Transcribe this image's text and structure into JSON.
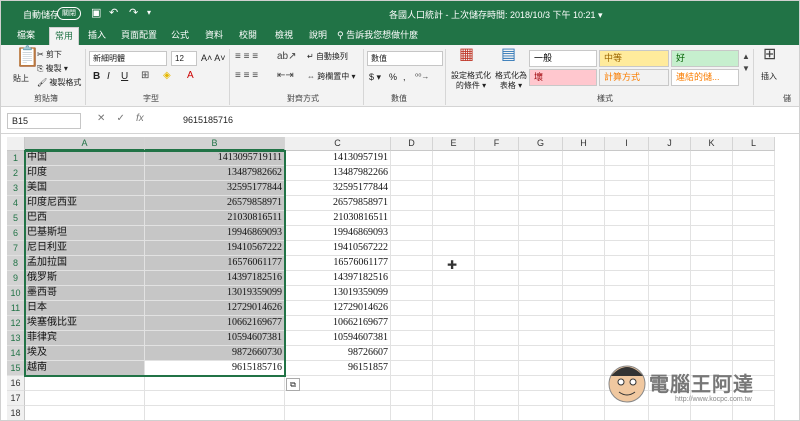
{
  "titlebar": {
    "autosave_label": "自動儲存",
    "autosave_state": "關閉",
    "document_title": "各國人口統計 - 上次儲存時間: 2018/10/3 下午 10:21 ▾"
  },
  "tabs": [
    "檔案",
    "常用",
    "插入",
    "頁面配置",
    "公式",
    "資料",
    "校閱",
    "檢視",
    "說明"
  ],
  "active_tab": "常用",
  "tell_me": "告訴我您想做什麼",
  "ribbon": {
    "clipboard": {
      "label": "剪貼簿",
      "paste": "貼上",
      "cut": "剪下",
      "copy": "複製 ▾",
      "format_painter": "複製格式"
    },
    "font": {
      "label": "字型",
      "font_name": "新細明體",
      "font_size": "12",
      "bold": "B",
      "italic": "I",
      "underline": "U"
    },
    "alignment": {
      "label": "對齊方式",
      "wrap_text": "自動換列",
      "merge_center": "跨欄置中 ▾"
    },
    "number": {
      "label": "數值",
      "format": "數值",
      "currency": "$ ▾",
      "percent": "%",
      "comma": ","
    },
    "styles": {
      "label": "樣式",
      "conditional": "設定格式化的條件 ▾",
      "as_table": "格式化為表格 ▾",
      "cells": [
        {
          "text": "一般",
          "bg": "#ffffff",
          "fg": "#000000"
        },
        {
          "text": "中等",
          "bg": "#ffeb9c",
          "fg": "#9c6500"
        },
        {
          "text": "好",
          "bg": "#c6efce",
          "fg": "#006100"
        },
        {
          "text": "壞",
          "bg": "#ffc7ce",
          "fg": "#9c0006"
        },
        {
          "text": "計算方式",
          "bg": "#f2f2f2",
          "fg": "#fa7d00"
        },
        {
          "text": "連結的儲...",
          "bg": "#ffffff",
          "fg": "#fa7d00"
        }
      ]
    },
    "cells": {
      "insert": "插入",
      "label": "儲"
    }
  },
  "formula_bar": {
    "name_box": "B15",
    "cancel": "✕",
    "enter": "✓",
    "fx": "fx",
    "value": "9615185716"
  },
  "columns": [
    "A",
    "B",
    "C",
    "D",
    "E",
    "F",
    "G",
    "H",
    "I",
    "J",
    "K",
    "L"
  ],
  "rows": [
    {
      "n": "1",
      "a": "中国",
      "b": "1413095719111",
      "c": "14130957191"
    },
    {
      "n": "2",
      "a": "印度",
      "b": "13487982662",
      "c": "13487982266"
    },
    {
      "n": "3",
      "a": "美国",
      "b": "32595177844",
      "c": "32595177844"
    },
    {
      "n": "4",
      "a": "印度尼西亚",
      "b": "26579858971",
      "c": "26579858971"
    },
    {
      "n": "5",
      "a": "巴西",
      "b": "21030816511",
      "c": "21030816511"
    },
    {
      "n": "6",
      "a": "巴基斯坦",
      "b": "19946869093",
      "c": "19946869093"
    },
    {
      "n": "7",
      "a": "尼日利亚",
      "b": "19410567222",
      "c": "19410567222"
    },
    {
      "n": "8",
      "a": "孟加拉国",
      "b": "16576061177",
      "c": "16576061177"
    },
    {
      "n": "9",
      "a": "俄罗斯",
      "b": "14397182516",
      "c": "14397182516"
    },
    {
      "n": "10",
      "a": "墨西哥",
      "b": "13019359099",
      "c": "13019359099"
    },
    {
      "n": "11",
      "a": "日本",
      "b": "12729014626",
      "c": "12729014626"
    },
    {
      "n": "12",
      "a": "埃塞俄比亚",
      "b": "10662169677",
      "c": "10662169677"
    },
    {
      "n": "13",
      "a": "菲律宾",
      "b": "10594607381",
      "c": "10594607381"
    },
    {
      "n": "14",
      "a": "埃及",
      "b": "9872660730",
      "c": "98726607"
    },
    {
      "n": "15",
      "a": "越南",
      "b": "9615185716",
      "c": "96151857"
    },
    {
      "n": "16",
      "a": "",
      "b": "",
      "c": ""
    },
    {
      "n": "17",
      "a": "",
      "b": "",
      "c": ""
    },
    {
      "n": "18",
      "a": "",
      "b": "",
      "c": ""
    }
  ],
  "watermark": {
    "site": "電腦王阿達",
    "url": "http://www.kocpc.com.tw"
  }
}
